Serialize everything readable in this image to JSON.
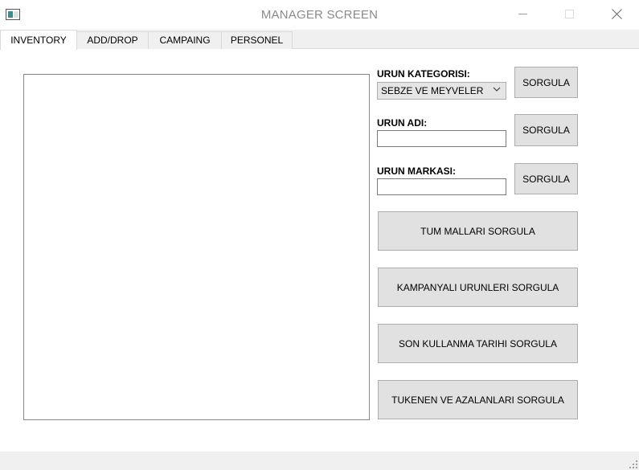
{
  "window": {
    "title": "MANAGER SCREEN"
  },
  "tabs": [
    {
      "label": "INVENTORY",
      "active": true
    },
    {
      "label": "ADD/DROP",
      "active": false
    },
    {
      "label": "CAMPAING",
      "active": false
    },
    {
      "label": "PERSONEL",
      "active": false
    }
  ],
  "inventory": {
    "category": {
      "label": "URUN KATEGORISI:",
      "selected": "SEBZE VE MEYVELER",
      "query_button": "SORGULA"
    },
    "product_name": {
      "label": "URUN ADI:",
      "value": "",
      "query_button": "SORGULA"
    },
    "product_brand": {
      "label": "URUN MARKASI:",
      "value": "",
      "query_button": "SORGULA"
    },
    "actions": {
      "all_goods": "TUM MALLARI SORGULA",
      "campaign_products": "KAMPANYALI URUNLERI SORGULA",
      "expiry_date": "SON KULLANMA TARIHI SORGULA",
      "depleted_low": "TUKENEN VE AZALANLARI SORGULA"
    }
  },
  "icons": {
    "app": "app-window-icon",
    "minimize": "minimize-icon",
    "maximize": "maximize-icon",
    "close": "close-icon",
    "dropdown": "chevron-down-icon",
    "resize": "resize-grip-icon"
  }
}
